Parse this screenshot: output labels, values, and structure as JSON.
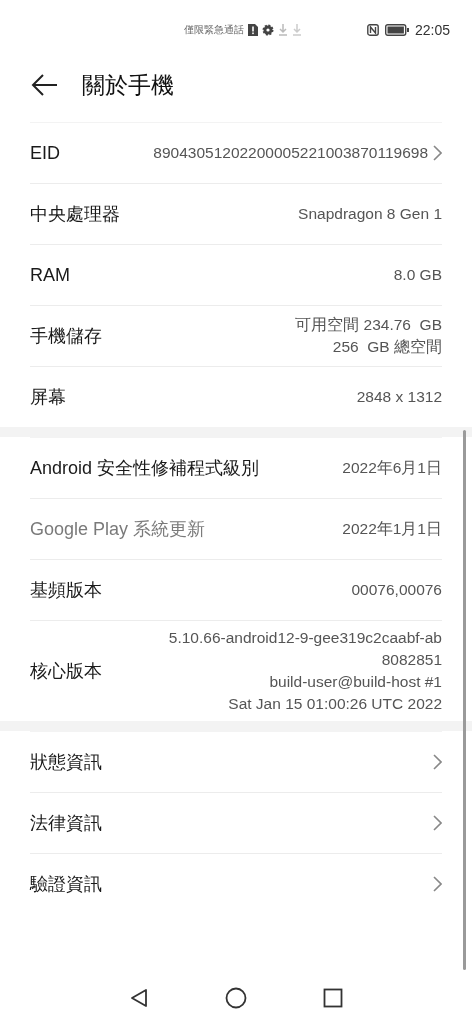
{
  "status_bar": {
    "carrier_text": "僅限緊急通話",
    "time": "22:05"
  },
  "header": {
    "title": "關於手機"
  },
  "sections": [
    {
      "rows": [
        {
          "label": "EID",
          "values": [
            "89043051202200005221003870119698"
          ],
          "chevron": true,
          "disabled": false
        },
        {
          "label": "中央處理器",
          "values": [
            "Snapdragon 8 Gen 1"
          ],
          "chevron": false,
          "disabled": false
        },
        {
          "label": "RAM",
          "values": [
            "8.0 GB"
          ],
          "chevron": false,
          "disabled": false
        },
        {
          "label": "手機儲存",
          "values": [
            "可用空間 234.76  GB",
            "256  GB 總空間"
          ],
          "chevron": false,
          "disabled": false
        },
        {
          "label": "屏幕",
          "values": [
            "2848 x 1312"
          ],
          "chevron": false,
          "disabled": false
        }
      ]
    },
    {
      "rows": [
        {
          "label": "Android 安全性修補程式級別",
          "values": [
            "2022年6月1日"
          ],
          "chevron": false,
          "disabled": false
        },
        {
          "label": "Google Play 系統更新",
          "values": [
            "2022年1月1日"
          ],
          "chevron": false,
          "disabled": true
        },
        {
          "label": "基頻版本",
          "values": [
            "00076,00076"
          ],
          "chevron": false,
          "disabled": false
        },
        {
          "label": "核心版本",
          "values": [
            "5.10.66-android12-9-gee319c2caabf-ab",
            "8082851",
            "build-user@build-host #1",
            "Sat Jan 15 01:00:26 UTC 2022"
          ],
          "chevron": false,
          "disabled": false
        }
      ]
    },
    {
      "rows": [
        {
          "label": "狀態資訊",
          "values": [],
          "chevron": true,
          "disabled": false
        },
        {
          "label": "法律資訊",
          "values": [],
          "chevron": true,
          "disabled": false
        },
        {
          "label": "驗證資訊",
          "values": [],
          "chevron": true,
          "disabled": false
        }
      ]
    }
  ]
}
